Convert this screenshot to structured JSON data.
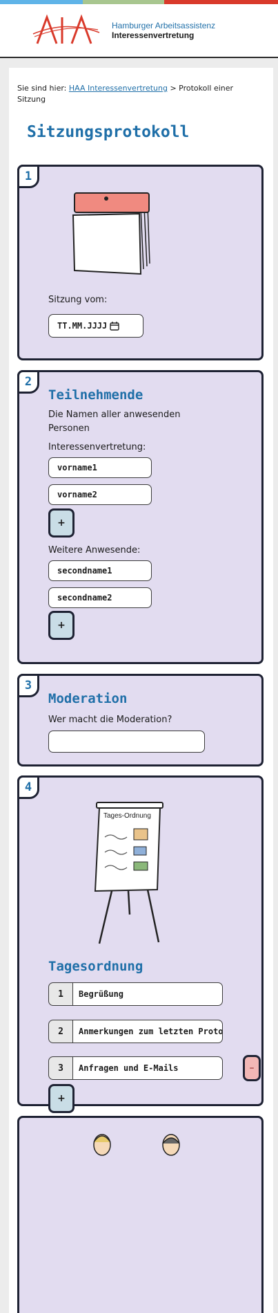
{
  "colors": {
    "accent": "#1f6fa8",
    "card_bg": "#e2dcf0",
    "topbar": [
      "#5fb4e8",
      "#a8c68f",
      "#d93a2b"
    ]
  },
  "header": {
    "org_line1": "Hamburger Arbeitsassistenz",
    "org_line2": "Interessenvertretung"
  },
  "breadcrumb": {
    "prefix": "Sie sind hier:",
    "link": "HAA Interessenvertretung",
    "separator": ">",
    "current": "Protokoll einer Sitzung"
  },
  "page_title": "Sitzungsprotokoll",
  "sections": {
    "s1": {
      "number": "1",
      "date_label": "Sitzung vom:",
      "date_placeholder": "TT.MM.JJJJ",
      "calendar_icon": "calendar-icon"
    },
    "s2": {
      "number": "2",
      "title": "Teilnehmende",
      "description": "Die Namen aller anwesenden Personen",
      "group1_label": "Interessenvertretung:",
      "group1_values": [
        "vorname1",
        "vorname2"
      ],
      "group2_label": "Weitere Anwesende:",
      "group2_values": [
        "secondname1",
        "secondname2"
      ],
      "add_label": "+"
    },
    "s3": {
      "number": "3",
      "title": "Moderation",
      "question": "Wer macht die Moderation?",
      "value": ""
    },
    "s4": {
      "number": "4",
      "title": "Tagesordnung",
      "flipchart_title": "Tages-Ordnung",
      "items": [
        {
          "num": "1",
          "text": "Begrüßung"
        },
        {
          "num": "2",
          "text": "Anmerkungen zum letzten Protokoll"
        },
        {
          "num": "3",
          "text": "Anfragen und E-Mails"
        }
      ],
      "remove_label": "–",
      "add_label": "+"
    },
    "s5": {
      "illustration": "people-icon"
    }
  }
}
